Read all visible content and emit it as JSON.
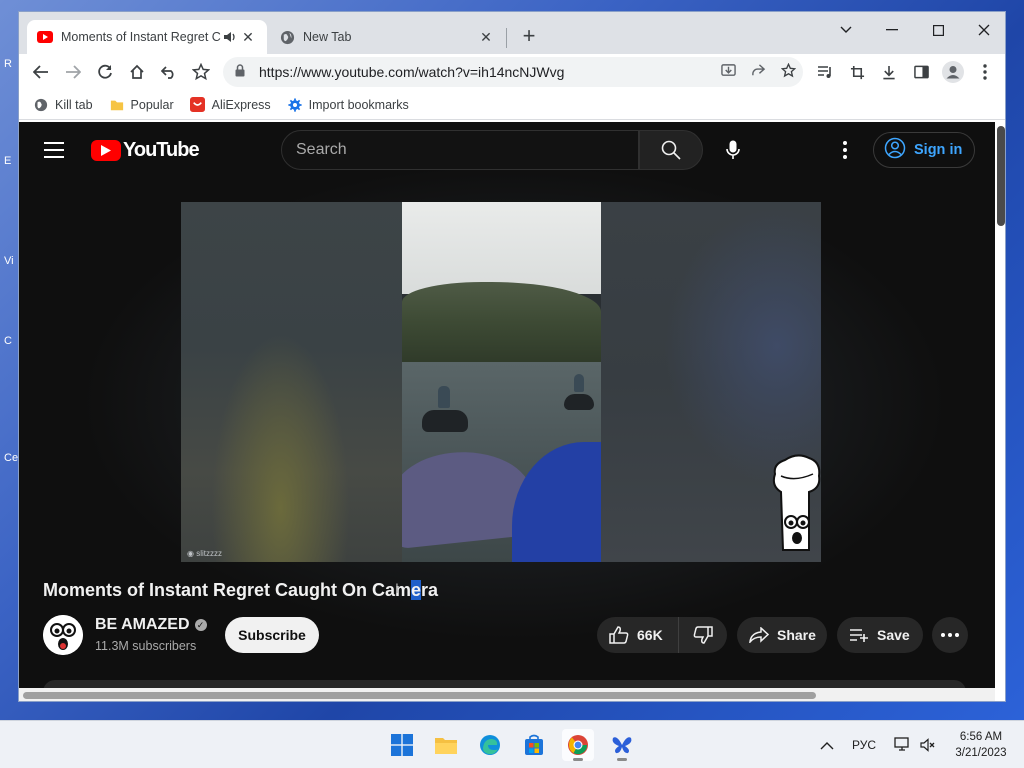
{
  "desktop": {
    "icon_letters": [
      "R",
      "E",
      "Vi",
      "C",
      "Ce"
    ]
  },
  "browser": {
    "tabs": [
      {
        "title": "Moments of Instant Regret C",
        "active": true
      },
      {
        "title": "New Tab",
        "active": false
      }
    ],
    "url": "https://www.youtube.com/watch?v=ih14ncNJWvg",
    "bookmarks": [
      {
        "label": "Kill tab",
        "icon": "globe-icon"
      },
      {
        "label": "Popular",
        "icon": "folder-icon"
      },
      {
        "label": "AliExpress",
        "icon": "aliexpress-icon"
      },
      {
        "label": "Import bookmarks",
        "icon": "gear-icon"
      }
    ]
  },
  "youtube": {
    "logo_text": "YouTube",
    "search_placeholder": "Search",
    "sign_in_label": "Sign in",
    "video": {
      "watermark": "slitzzzz",
      "title_before_selection": "Moments of Instant Regret Caught On Cam",
      "title_selected": "e",
      "title_after_selection": "ra"
    },
    "channel": {
      "name": "BE AMAZED",
      "subscribers": "11.3M subscribers",
      "subscribe_label": "Subscribe"
    },
    "actions": {
      "likes": "66K",
      "share_label": "Share",
      "save_label": "Save"
    }
  },
  "taskbar": {
    "language": "РУС",
    "time": "6:56 AM",
    "date": "3/21/2023"
  }
}
